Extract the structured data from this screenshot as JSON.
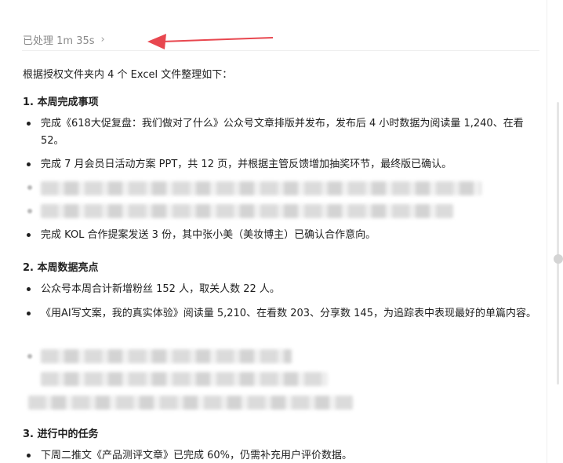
{
  "status": {
    "label": "已处理 1m 35s",
    "chevron": "›"
  },
  "intro": "根据授权文件夹内 4 个 Excel 文件整理如下：",
  "sections": [
    {
      "heading": "1. 本周完成事项",
      "items": [
        "完成《618大促复盘：我们做对了什么》公众号文章排版并发布，发布后 4 小时数据为阅读量 1,240、在看 52。",
        "完成 7 月会员日活动方案 PPT，共 12 页，并根据主管反馈增加抽奖环节，最终版已确认。",
        "完成 KOL 合作提案发送 3 份，其中张小美（美妆博主）已确认合作意向。"
      ]
    },
    {
      "heading": "2. 本周数据亮点",
      "items": [
        "公众号本周合计新增粉丝 152 人，取关人数 22 人。",
        "《用AI写文案，我的真实体验》阅读量 5,210、在看数 203、分享数 145，为追踪表中表现最好的单篇内容。"
      ]
    },
    {
      "heading": "3. 进行中的任务",
      "items": [
        "下周二推文《产品测评文章》已完成 60%，仍需补充用户评价数据。"
      ]
    }
  ],
  "colors": {
    "arrow": "#e8474f",
    "text": "#1f1f1f",
    "muted": "#8a8a8a"
  }
}
